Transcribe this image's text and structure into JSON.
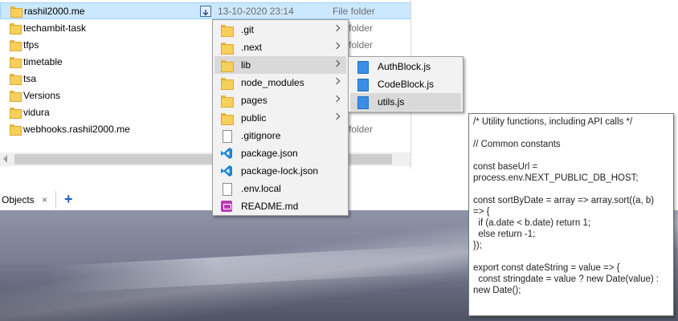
{
  "explorer": {
    "rows": [
      {
        "name": "rashil2000.me",
        "date": "13-10-2020 23:14",
        "type": "File folder",
        "selected": true
      },
      {
        "name": "techambit-task",
        "partial": "folder"
      },
      {
        "name": "tfps",
        "partial": "folder"
      },
      {
        "name": "timetable",
        "partial": ""
      },
      {
        "name": "tsa",
        "partial": ""
      },
      {
        "name": "Versions",
        "partial": ""
      },
      {
        "name": "vidura",
        "partial": ""
      },
      {
        "name": "webhooks.rashil2000.me",
        "partial": "folder"
      }
    ]
  },
  "tabs": {
    "objects_label": "Objects",
    "close_glyph": "×",
    "add_glyph": "+"
  },
  "menu_level1": [
    {
      "label": ".git",
      "icon": "folder-icon",
      "submenu": true
    },
    {
      "label": ".next",
      "icon": "folder-icon",
      "submenu": true
    },
    {
      "label": "lib",
      "icon": "folder-icon",
      "submenu": true,
      "highlighted": true
    },
    {
      "label": "node_modules",
      "icon": "folder-icon",
      "submenu": true
    },
    {
      "label": "pages",
      "icon": "folder-icon",
      "submenu": true
    },
    {
      "label": "public",
      "icon": "folder-icon",
      "submenu": true
    },
    {
      "label": ".gitignore",
      "icon": "file-icon"
    },
    {
      "label": "package.json",
      "icon": "vscode-icon"
    },
    {
      "label": "package-lock.json",
      "icon": "vscode-icon"
    },
    {
      "label": ".env.local",
      "icon": "file-icon"
    },
    {
      "label": "README.md",
      "icon": "markdown-icon"
    }
  ],
  "menu_level2": [
    {
      "label": "AuthBlock.js",
      "icon": "js-file-icon"
    },
    {
      "label": "CodeBlock.js",
      "icon": "js-file-icon"
    },
    {
      "label": "utils.js",
      "icon": "js-file-icon",
      "highlighted": true
    }
  ],
  "tooltip": {
    "text": "/* Utility functions, including API calls */\n\n// Common constants\n\nconst baseUrl =\nprocess.env.NEXT_PUBLIC_DB_HOST;\n\nconst sortByDate = array => array.sort((a, b)\n=> {\n  if (a.date < b.date) return 1;\n  else return -1;\n});\n\nexport const dateString = value => {\n  const stringdate = value ? new Date(value) :\nnew Date();"
  },
  "colors": {
    "selection": "#cce8ff",
    "menu_bg": "#f2f2f2",
    "menu_highlight": "#d9d9d9",
    "accent": "#1e5fc8"
  }
}
